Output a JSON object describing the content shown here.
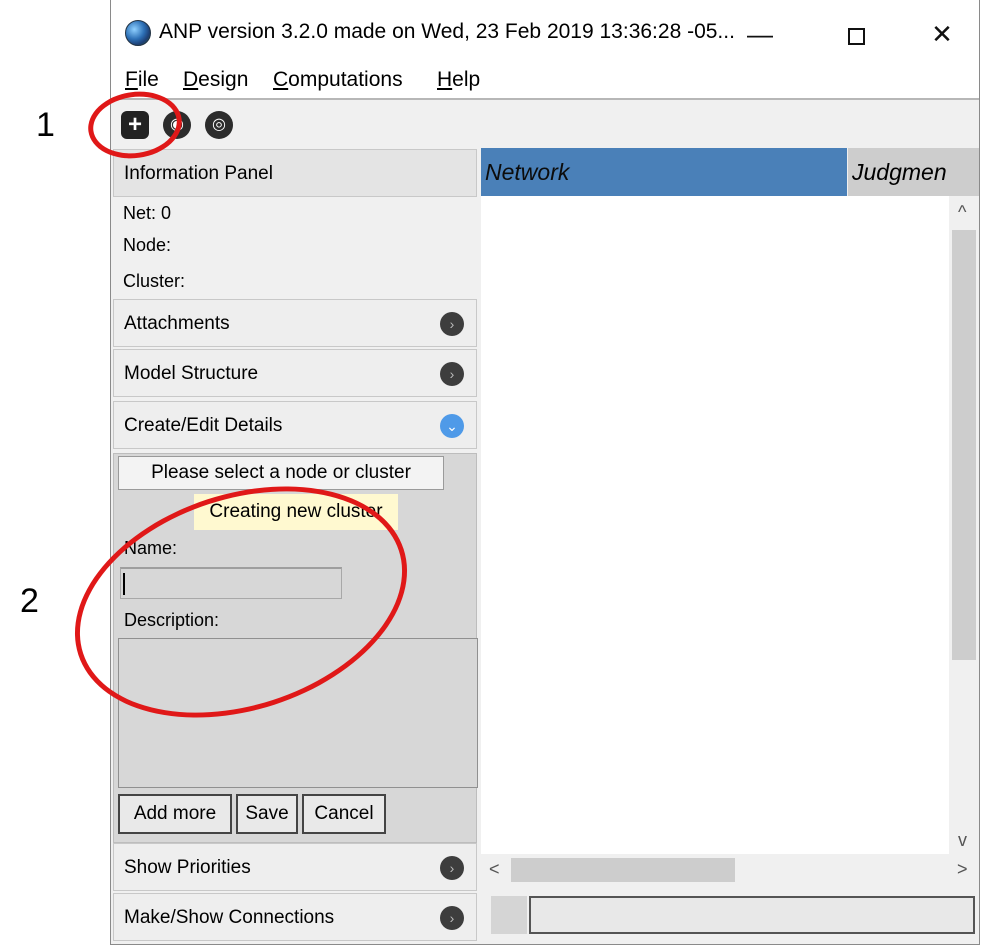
{
  "annotations": {
    "one": "1",
    "two": "2"
  },
  "window": {
    "title": "ANP version 3.2.0 made on Wed, 23 Feb 2019 13:36:28 -05...",
    "minimize": "—",
    "close": "✕"
  },
  "menu": [
    {
      "pre": "",
      "accel": "F",
      "rest": "ile"
    },
    {
      "pre": "",
      "accel": "D",
      "rest": "esign"
    },
    {
      "pre": "",
      "accel": "C",
      "rest": "omputations"
    },
    {
      "pre": "",
      "accel": "H",
      "rest": "elp"
    }
  ],
  "toolbar": {
    "new_icon": "+",
    "view_icon": "◉",
    "zoom_icon": "◎"
  },
  "panel": {
    "info_header": "Information Panel",
    "net": "Net: 0",
    "node": "Node:",
    "cluster": "Cluster:",
    "attachments": "Attachments",
    "model_structure": "Model Structure",
    "create_edit": "Create/Edit Details",
    "show_priorities": "Show Priorities",
    "make_connections": "Make/Show Connections"
  },
  "details": {
    "selection": "Please select a node or cluster",
    "tooltip": "Creating new cluster",
    "name_label": "Name:",
    "name_value": "",
    "description_label": "Description:",
    "add_more": "Add more",
    "save": "Save",
    "cancel": "Cancel"
  },
  "tabs": {
    "network": "Network",
    "judgments": "Judgmen"
  },
  "scroll": {
    "up": "^",
    "down": "v",
    "left": "<",
    "right": ">"
  },
  "colors": {
    "tab_active": "#4a80b8",
    "annotation": "#e01818",
    "tooltip_bg": "#fff9d0"
  }
}
